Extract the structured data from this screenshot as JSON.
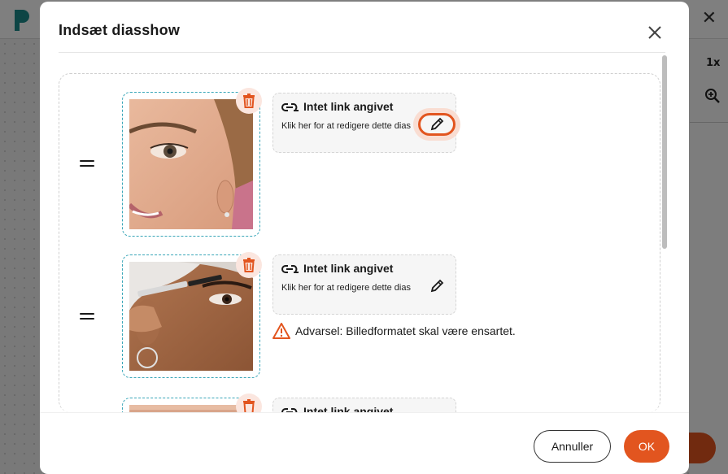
{
  "background": {
    "zoom_label": "1x"
  },
  "dialog": {
    "title": "Indsæt diasshow",
    "close_icon": "close-icon",
    "accent_color": "#e2551f",
    "slides": [
      {
        "image": "face-closeup-photo",
        "link_title": "Intet link angivet",
        "link_hint": "Klik her for at redigere dette dias",
        "warning": ""
      },
      {
        "image": "mascara-application-photo",
        "link_title": "Intet link angivet",
        "link_hint": "Klik her for at redigere dette dias",
        "warning": "Advarsel: Billedformatet skal være ensartet."
      },
      {
        "image": "partial-photo",
        "link_title": "Intet link angivet",
        "link_hint": "",
        "warning": ""
      }
    ],
    "footer": {
      "cancel_label": "Annuller",
      "ok_label": "OK"
    }
  }
}
